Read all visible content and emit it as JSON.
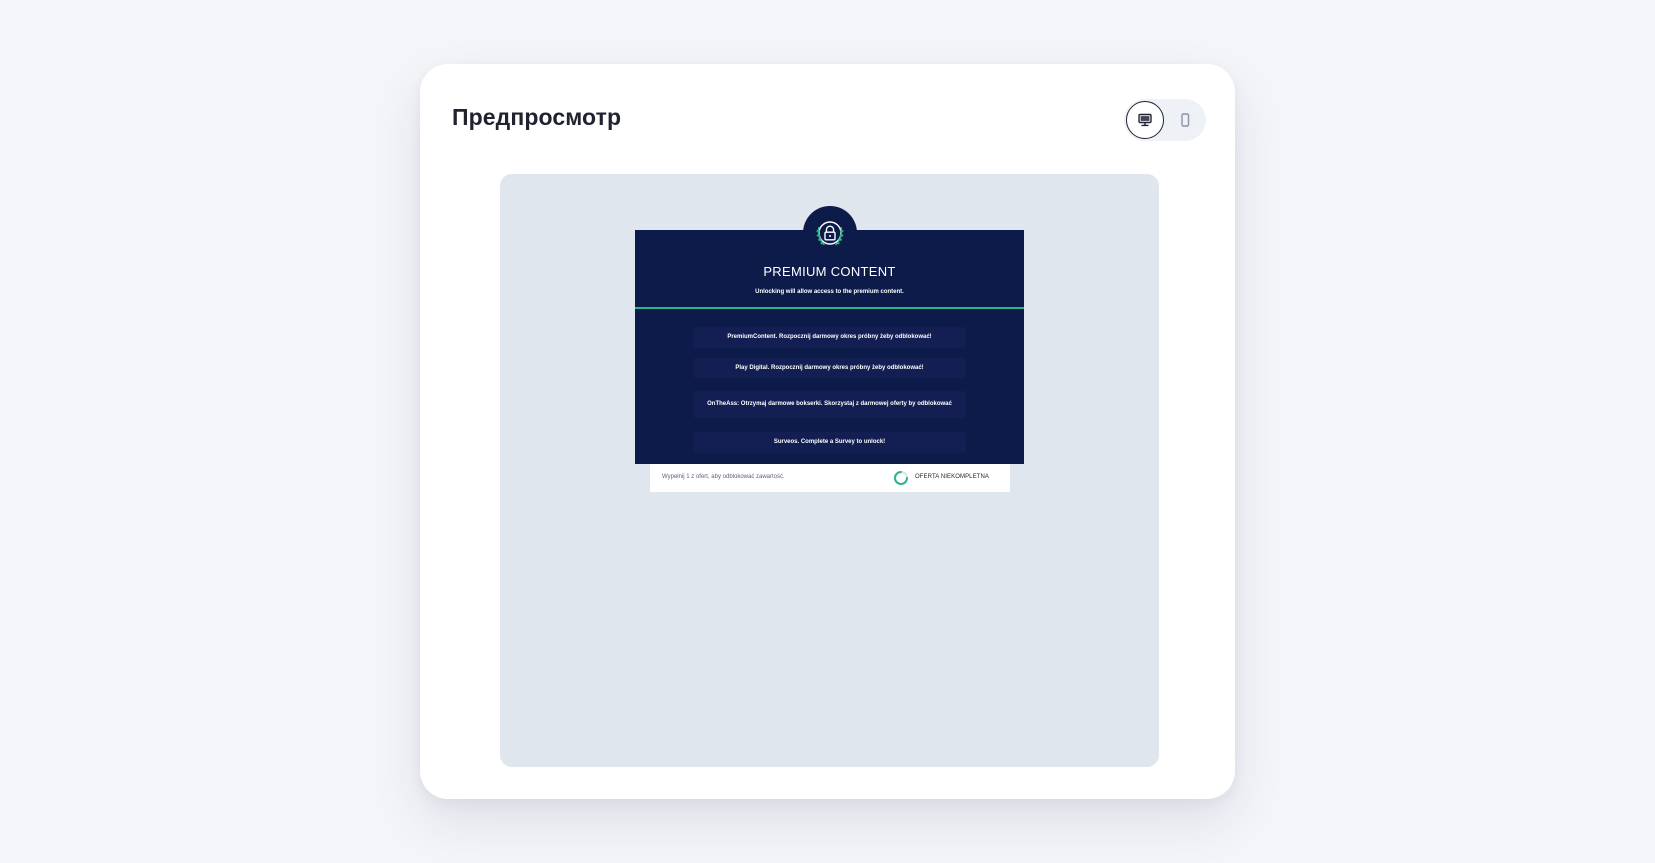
{
  "header": {
    "title": "Предпросмотр"
  },
  "device_toggle": {
    "options": [
      {
        "icon": "desktop-icon",
        "active": true
      },
      {
        "icon": "mobile-icon",
        "active": false
      }
    ]
  },
  "locker": {
    "badge_icon": "lock-icon",
    "title": "PREMIUM CONTENT",
    "subtitle": "Unlocking will allow access to the premium content.",
    "colors": {
      "background": "#0d1b4b",
      "offer_background": "#131f52",
      "accent": "#2fb584"
    },
    "offers": [
      {
        "label": "PremiumContent. Rozpocznij darmowy okres próbny żeby odblokować!"
      },
      {
        "label": "Play Digital. Rozpocznij darmowy okres próbny żeby odblokować!"
      },
      {
        "label": "OnTheAss: Otrzymaj darmowe bokserki. Skorzystaj z darmowej oferty by odblokować"
      },
      {
        "label": "Surveos. Complete a Survey to unlock!"
      }
    ]
  },
  "status": {
    "text": "Wypełnij 1 z ofert, aby odblokować zawartość.",
    "label": "OFERTA NIEKOMPLETNA"
  }
}
